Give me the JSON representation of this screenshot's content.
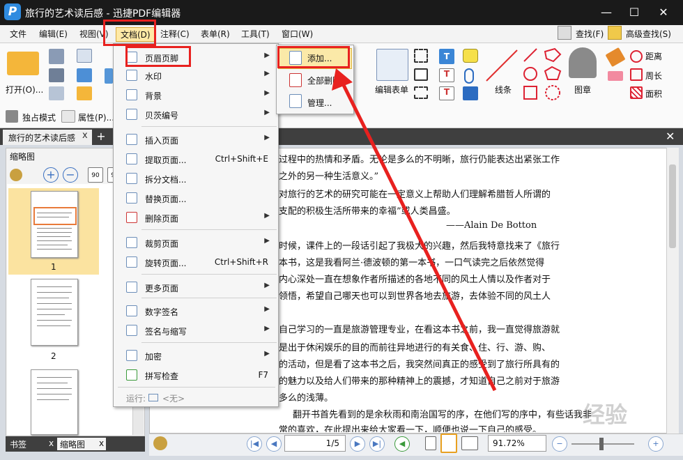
{
  "app": {
    "title": "旅行的艺术读后感 - 迅捷PDF编辑器",
    "logo": "P"
  },
  "window_buttons": {
    "minimize": "—",
    "maximize": "☐",
    "close": "✕"
  },
  "menus": [
    "文件",
    "编辑(E)",
    "视图(V)",
    "文档(D)",
    "注释(C)",
    "表单(R)",
    "工具(T)",
    "窗口(W)"
  ],
  "ribbon": {
    "open_label": "打开(O)...",
    "exclusive_mode": "独占模式",
    "properties": "属性(P)...",
    "edit_form": "编辑表单",
    "lines": "线条",
    "stamp": "图章",
    "distance": "距离",
    "perimeter": "周长",
    "area": "面积",
    "find": "查找(F)",
    "advanced_find": "高级查找(S)"
  },
  "doc_tab": {
    "label": "旅行的艺术读后感",
    "close": "x",
    "add": "+"
  },
  "left_panel": {
    "title": "缩略图",
    "page_labels": [
      "1",
      "2"
    ],
    "tab_bookmarks": "书签",
    "tab_thumbs": "缩略图",
    "close": "x"
  },
  "document_menu": {
    "items": [
      {
        "label": "页眉页脚",
        "shortcut": "",
        "arrow": true
      },
      {
        "label": "水印",
        "shortcut": "",
        "arrow": true
      },
      {
        "label": "背景",
        "shortcut": "",
        "arrow": true
      },
      {
        "label": "贝茨编号",
        "shortcut": "",
        "arrow": true
      },
      {
        "label": "插入页面",
        "shortcut": "",
        "arrow": true
      },
      {
        "label": "提取页面...",
        "shortcut": "Ctrl+Shift+E",
        "arrow": false
      },
      {
        "label": "拆分文档...",
        "shortcut": "",
        "arrow": false
      },
      {
        "label": "替换页面...",
        "shortcut": "",
        "arrow": false
      },
      {
        "label": "删除页面",
        "shortcut": "",
        "arrow": true
      },
      {
        "label": "裁剪页面",
        "shortcut": "",
        "arrow": true
      },
      {
        "label": "旋转页面...",
        "shortcut": "Ctrl+Shift+R",
        "arrow": false
      },
      {
        "label": "更多页面",
        "shortcut": "",
        "arrow": true
      },
      {
        "label": "数字签名",
        "shortcut": "",
        "arrow": true
      },
      {
        "label": "签名与缩写",
        "shortcut": "",
        "arrow": true
      },
      {
        "label": "加密",
        "shortcut": "",
        "arrow": true
      },
      {
        "label": "拼写检查",
        "shortcut": "F7",
        "arrow": false
      }
    ],
    "run_label": "运行:",
    "run_value": "<无>"
  },
  "header_footer_submenu": [
    "添加...",
    "全部删除...",
    "管理..."
  ],
  "document_text": [
    "过程中的热情和矛盾。无论是多么的不明晰，旅行仍能表达出紧张工作",
    "之外的另一种生活意义。”",
    "对旅行的艺术的研究可能在一定意义上帮助人们理解希腊哲人所谓的",
    "支配的积极生活所带来的幸福”或人类昌盛。",
    "——Alain De Botton",
    "时候，课件上的一段话引起了我极大的兴趣，然后我特意找来了《旅行",
    "本书，这是我看阿兰·德波顿的第一本书，一口气读完之后依然觉得",
    "内心深处一直在想象作者所描述的各地不同的风土人情以及作者对于",
    "领悟，希望自己哪天也可以到世界各地去旅游，去体验不同的风土人",
    "自己学习的一直是旅游管理专业，在看这本书之前，我一直觉得旅游就",
    "是出于休闲娱乐的目的而前往异地进行的有关食、住、行、游、购、",
    "的活动，但是看了这本书之后，我突然间真正的感受到了旅行所具有的",
    "的魅力以及给人们带来的那种精神上的震撼，才知道自己之前对于旅游",
    "多么的浅薄。",
    "翻开书首先看到的是余秋雨和南治国写的序，在他们写的序中，有些话我非",
    "常的喜欢，在此提出来给大家看一下，顺便也说一下自己的感受。"
  ],
  "status": {
    "page": "1",
    "total": "5",
    "zoom": "91.72%"
  },
  "watermark": "经验"
}
